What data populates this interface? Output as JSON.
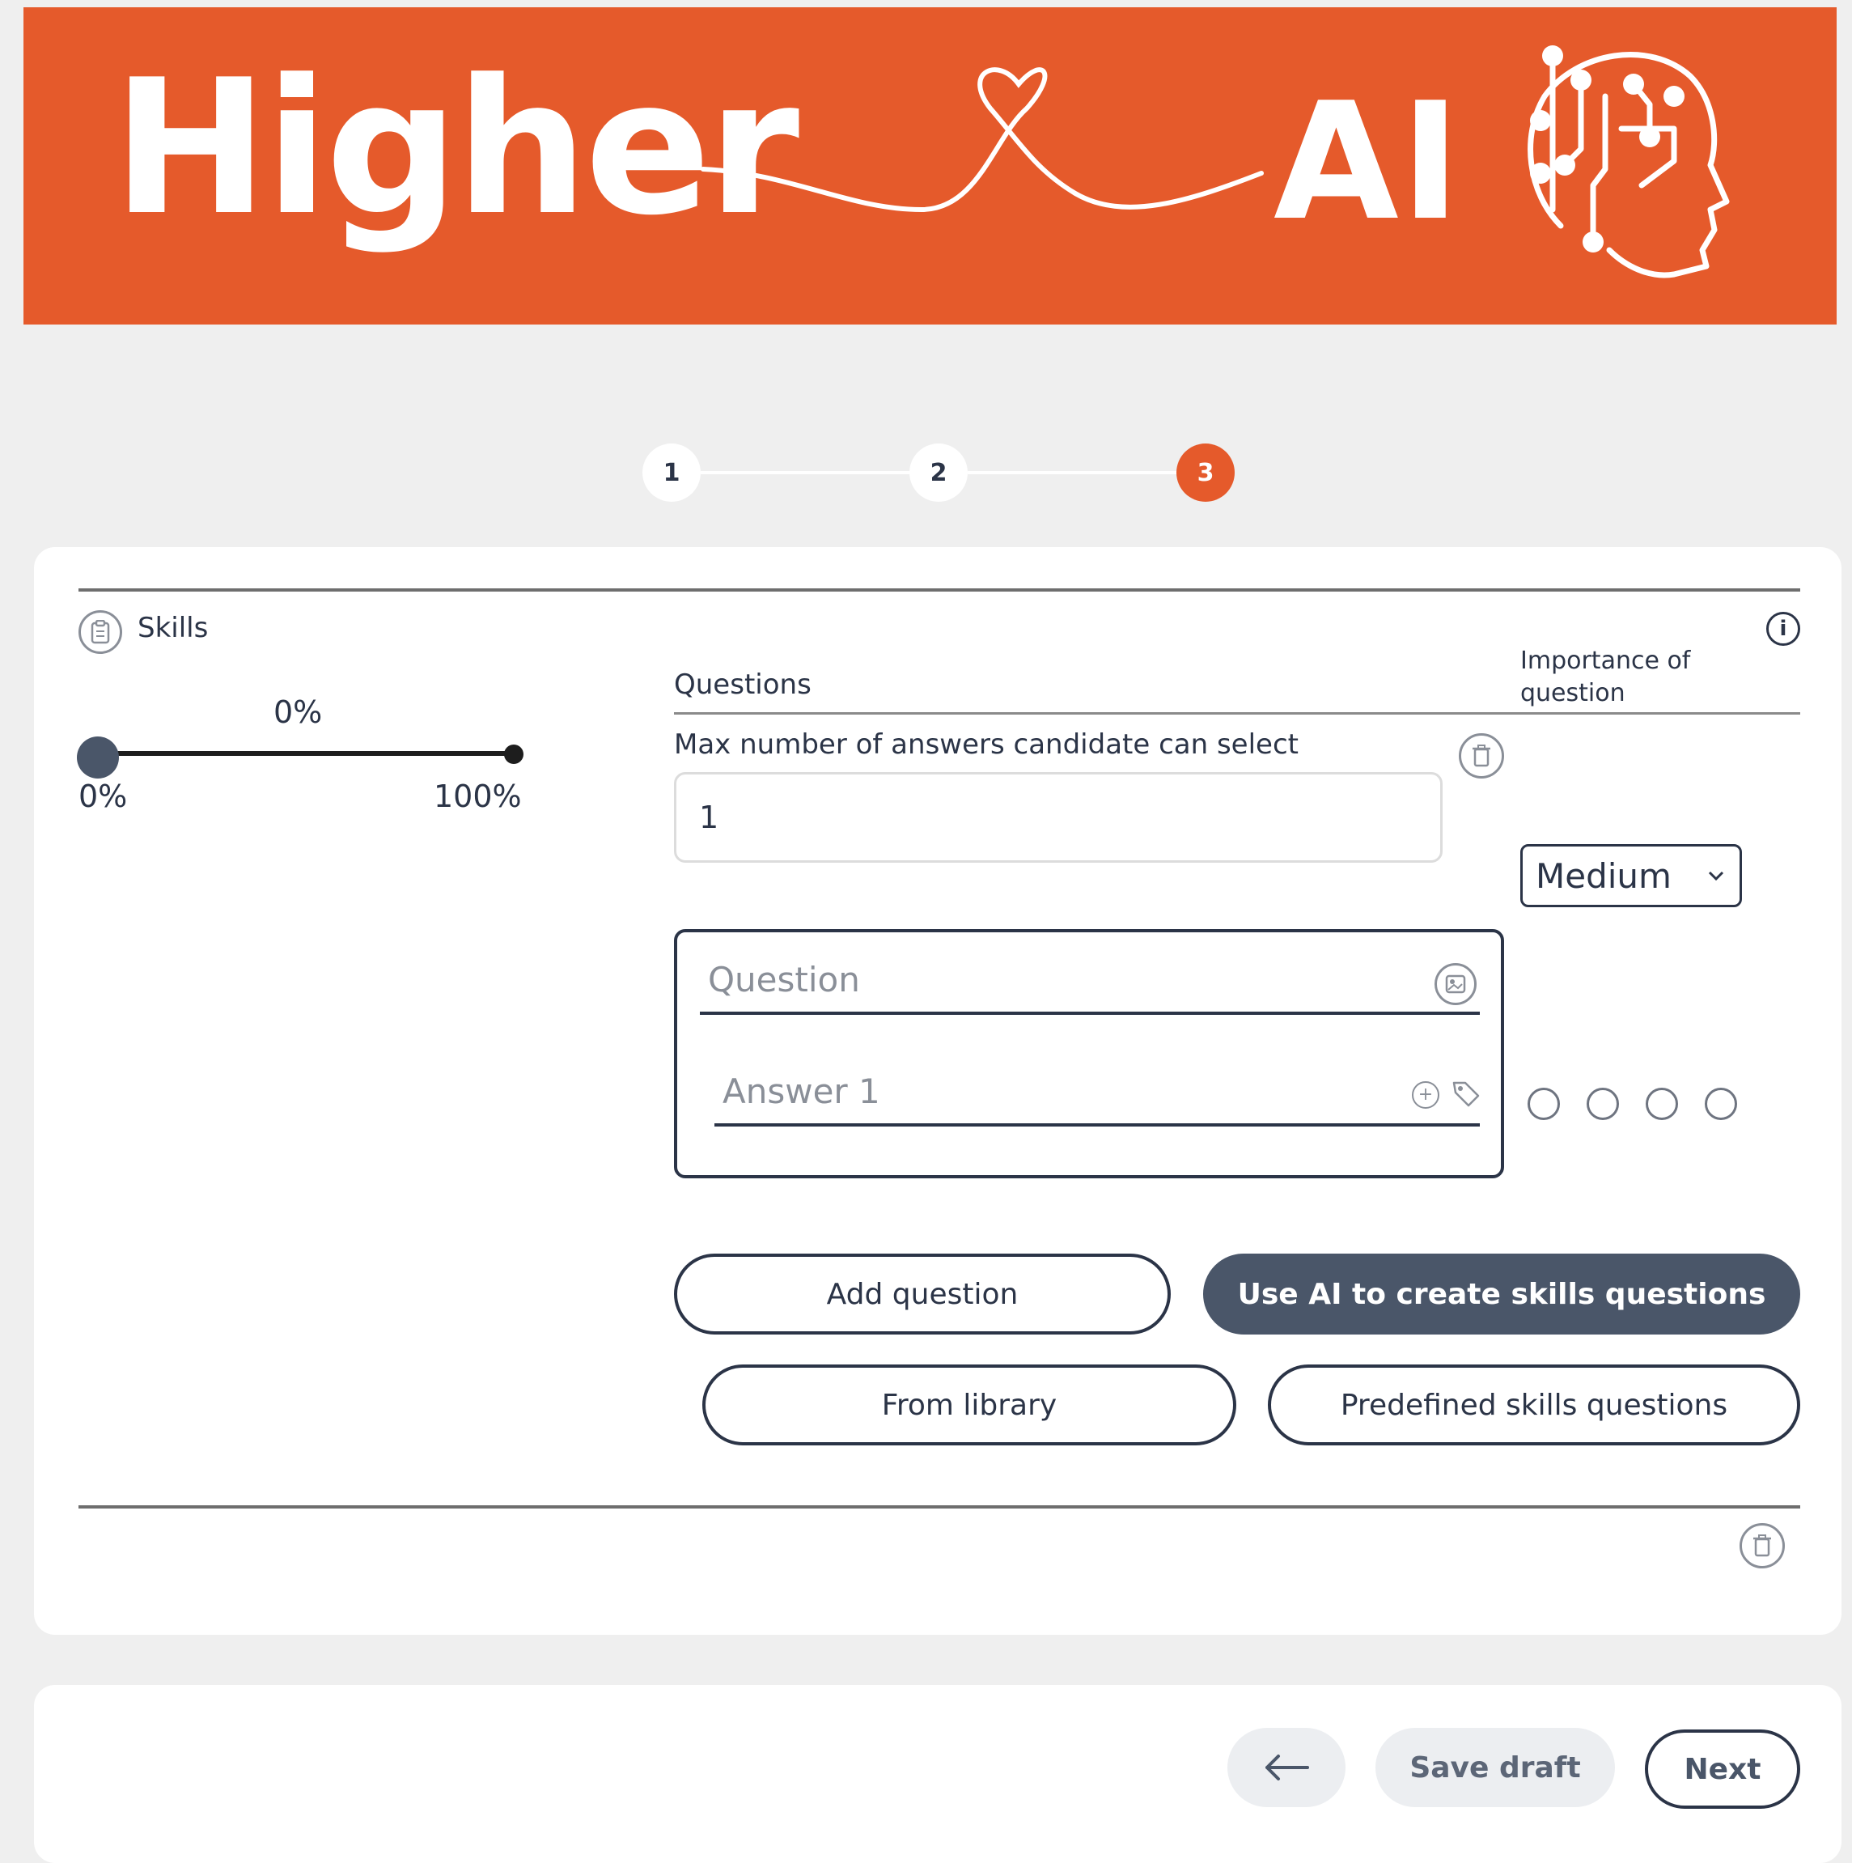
{
  "banner": {
    "brand_left": "Higher",
    "brand_right": "AI"
  },
  "stepper": {
    "steps": [
      "1",
      "2",
      "3"
    ],
    "active": 3
  },
  "skills": {
    "title": "Skills",
    "slider_value": "0%",
    "slider_min": "0%",
    "slider_max": "100%",
    "slider_level": 0
  },
  "questions": {
    "header": "Questions",
    "importance_header": "Importance of question",
    "max_answers_label": "Max number of answers candidate can select",
    "max_answers_value": "1",
    "importance_value": "Medium",
    "question_placeholder": "Question",
    "answer_placeholder": "Answer 1"
  },
  "actions": {
    "add_question": "Add question",
    "use_ai": "Use AI to create skills questions",
    "from_library": "From library",
    "predefined": "Predefined skills questions"
  },
  "footer": {
    "back_icon": "arrow-left-icon",
    "save_draft": "Save draft",
    "next": "Next"
  },
  "colors": {
    "accent": "#e55a2b",
    "dark": "#2b3447",
    "button_fill": "#4a5669"
  }
}
